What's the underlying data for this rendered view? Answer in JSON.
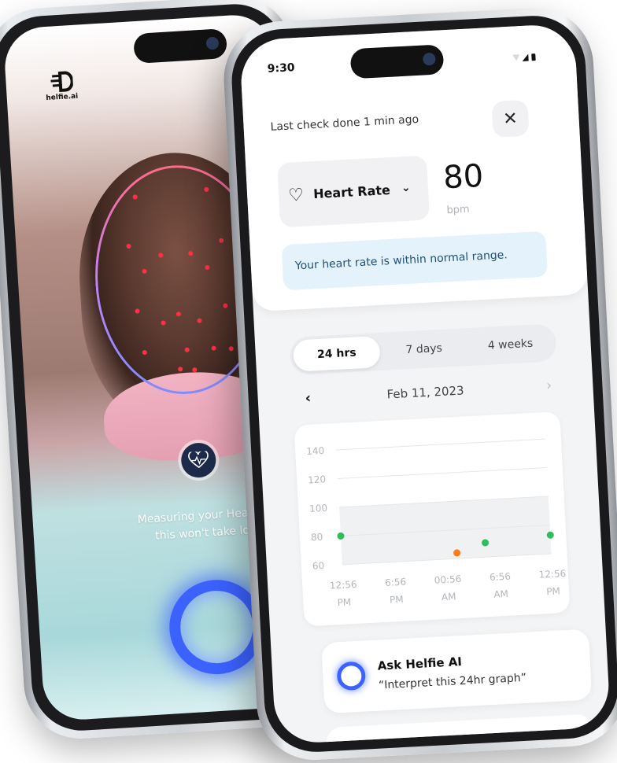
{
  "back_phone": {
    "brand": "helfie.ai",
    "measuring_line1": "Measuring your Heart Rat",
    "measuring_line2": "this won't take long"
  },
  "front_phone": {
    "status_time": "9:30",
    "last_check": "Last check done 1 min ago",
    "close_label": "✕",
    "metric": {
      "label": "Heart Rate",
      "value": "80",
      "unit": "bpm"
    },
    "normal_banner": "Your heart rate is within normal range.",
    "tabs": [
      {
        "label": "24 hrs",
        "active": true
      },
      {
        "label": "7 days",
        "active": false
      },
      {
        "label": "4 weeks",
        "active": false
      }
    ],
    "date_nav": {
      "prev": "‹",
      "date": "Feb 11, 2023",
      "next": "›"
    },
    "ask_ai": {
      "title": "Ask Helfie AI",
      "prompt": "“Interpret this 24hr graph”"
    }
  },
  "chart_data": {
    "type": "scatter",
    "title": "",
    "xlabel": "",
    "ylabel": "",
    "ylim": [
      60,
      140
    ],
    "yticks": [
      140,
      120,
      100,
      80,
      60
    ],
    "xtick_labels": [
      [
        "12:56",
        "PM"
      ],
      [
        "6:56",
        "PM"
      ],
      [
        "00:56",
        "AM"
      ],
      [
        "6:56",
        "AM"
      ],
      [
        "12:56",
        "PM"
      ]
    ],
    "normal_band": [
      60,
      100
    ],
    "points": [
      {
        "x": 0,
        "y": 80,
        "color": "#2ebd59"
      },
      {
        "x": 2.2,
        "y": 64,
        "color": "#ff7a1a"
      },
      {
        "x": 2.75,
        "y": 70,
        "color": "#2ebd59"
      },
      {
        "x": 4,
        "y": 73,
        "color": "#2ebd59"
      }
    ]
  },
  "colors": {
    "accent_blue": "#3b62ff",
    "banner_bg": "#e3f2fb",
    "normal_green": "#2ebd59",
    "alert_orange": "#ff7a1a"
  }
}
